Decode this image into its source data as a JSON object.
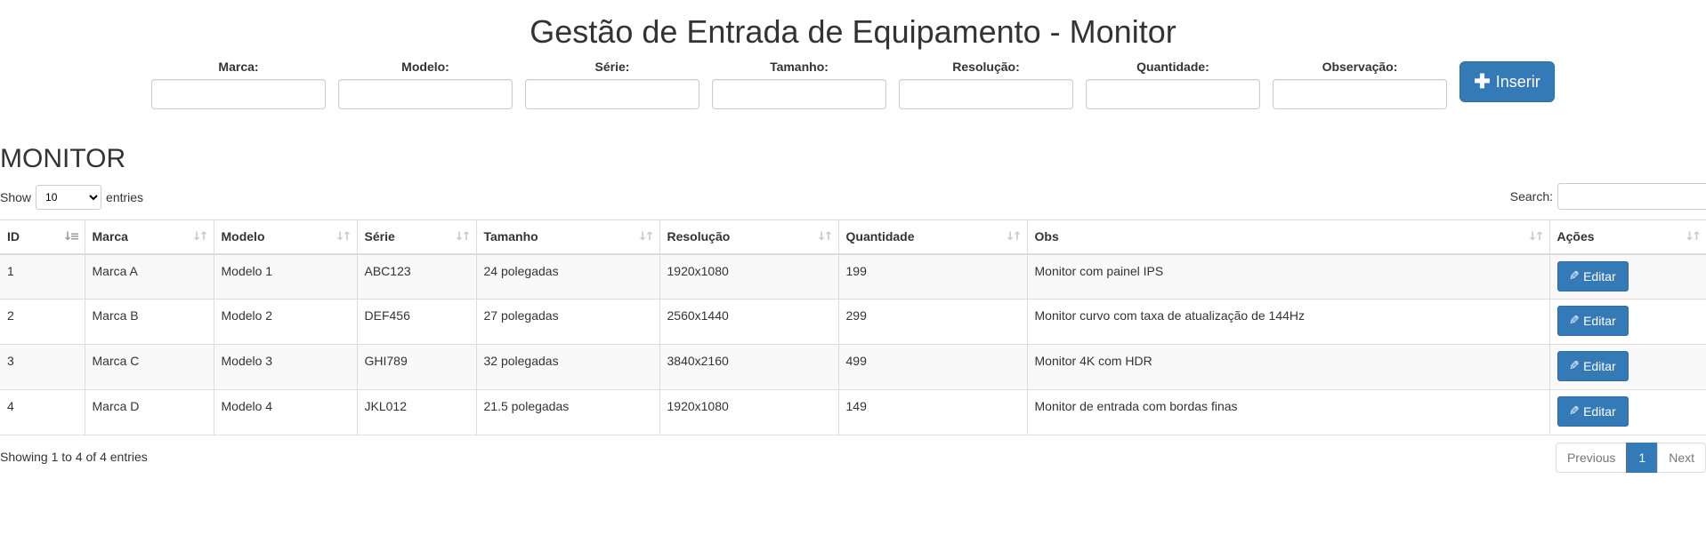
{
  "header": {
    "title": "Gestão de Entrada de Equipamento - Monitor"
  },
  "form": {
    "fields": [
      {
        "label": "Marca:",
        "value": "",
        "placeholder": ""
      },
      {
        "label": "Modelo:",
        "value": "",
        "placeholder": ""
      },
      {
        "label": "Série:",
        "value": "",
        "placeholder": ""
      },
      {
        "label": "Tamanho:",
        "value": "",
        "placeholder": ""
      },
      {
        "label": "Resolução:",
        "value": "",
        "placeholder": ""
      },
      {
        "label": "Quantidade:",
        "value": "",
        "placeholder": ""
      },
      {
        "label": "Observação:",
        "value": "",
        "placeholder": ""
      }
    ],
    "insert_label": "Inserir",
    "insert_icon": "plus-icon"
  },
  "section": {
    "title": "MONITOR"
  },
  "controls": {
    "show_label": "Show",
    "entries_label": "entries",
    "page_length": "10",
    "page_length_options": [
      "10"
    ],
    "search_label": "Search:",
    "search_value": ""
  },
  "table": {
    "columns": [
      "ID",
      "Marca",
      "Modelo",
      "Série",
      "Tamanho",
      "Resolução",
      "Quantidade",
      "Obs",
      "Ações"
    ],
    "sorted_column": "ID",
    "sort_direction": "ascending",
    "rows": [
      {
        "id": "1",
        "marca": "Marca A",
        "modelo": "Modelo 1",
        "serie": "ABC123",
        "tamanho": "24 polegadas",
        "resolucao": "1920x1080",
        "quantidade": "199",
        "obs": "Monitor com painel IPS"
      },
      {
        "id": "2",
        "marca": "Marca B",
        "modelo": "Modelo 2",
        "serie": "DEF456",
        "tamanho": "27 polegadas",
        "resolucao": "2560x1440",
        "quantidade": "299",
        "obs": "Monitor curvo com taxa de atualização de 144Hz"
      },
      {
        "id": "3",
        "marca": "Marca C",
        "modelo": "Modelo 3",
        "serie": "GHI789",
        "tamanho": "32 polegadas",
        "resolucao": "3840x2160",
        "quantidade": "499",
        "obs": "Monitor 4K com HDR"
      },
      {
        "id": "4",
        "marca": "Marca D",
        "modelo": "Modelo 4",
        "serie": "JKL012",
        "tamanho": "21.5 polegadas",
        "resolucao": "1920x1080",
        "quantidade": "149",
        "obs": "Monitor de entrada com bordas finas"
      }
    ],
    "edit_label": "Editar",
    "edit_icon": "pencil-icon"
  },
  "footer": {
    "info": "Showing 1 to 4 of 4 entries",
    "previous_label": "Previous",
    "current_page": "1",
    "next_label": "Next"
  },
  "colors": {
    "primary": "#337ab7",
    "stripe": "#f9f9f9",
    "border": "#dddddd"
  }
}
